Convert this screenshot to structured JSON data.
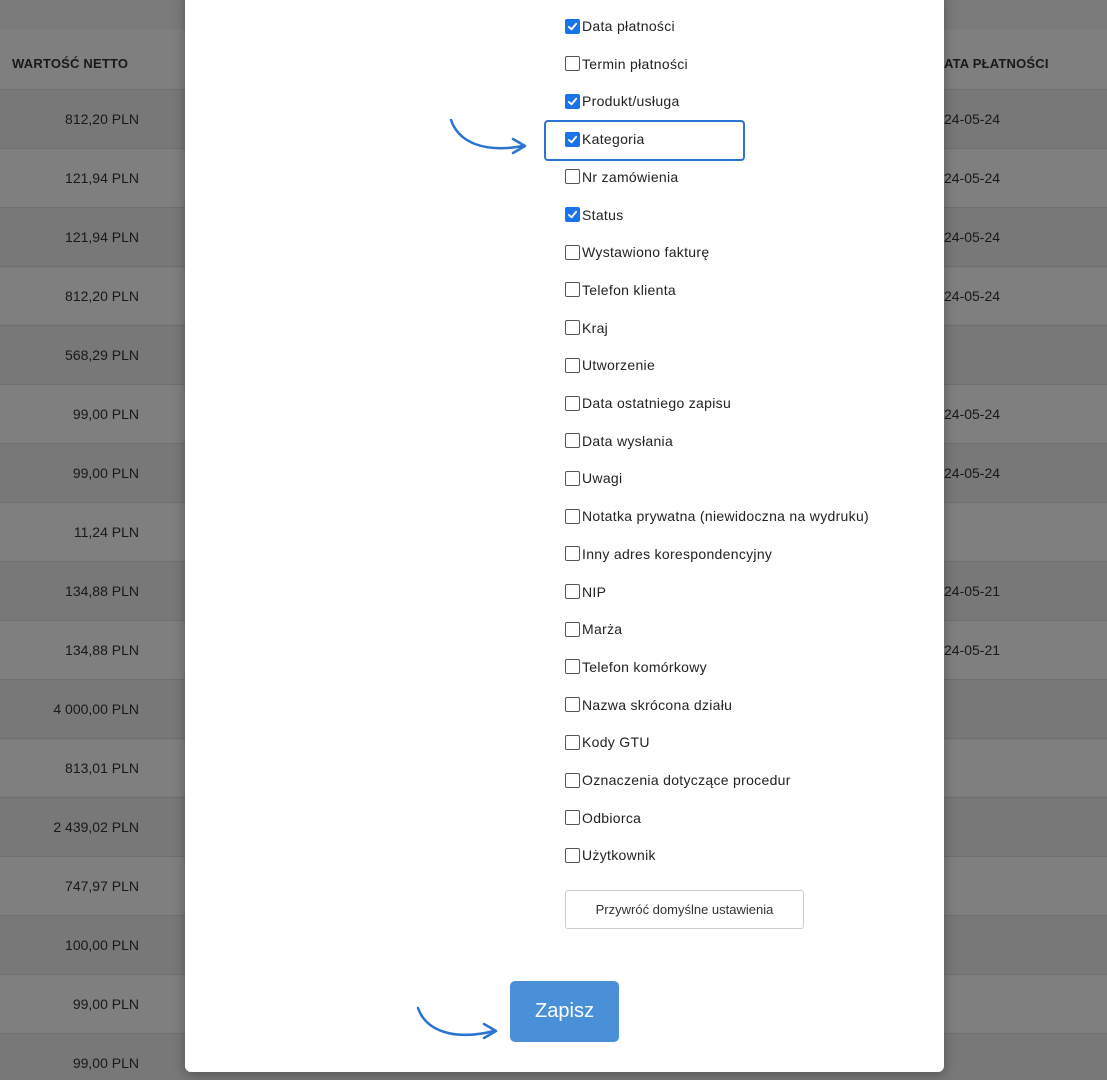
{
  "table": {
    "header_left": "WARTOŚĆ NETTO",
    "header_right": "ATA PŁATNOŚCI",
    "rows": [
      {
        "value": "812,20 PLN",
        "date": "24-05-24"
      },
      {
        "value": "121,94 PLN",
        "date": "24-05-24"
      },
      {
        "value": "121,94 PLN",
        "date": "24-05-24"
      },
      {
        "value": "812,20 PLN",
        "date": "24-05-24"
      },
      {
        "value": "568,29 PLN",
        "date": ""
      },
      {
        "value": "99,00 PLN",
        "date": "24-05-24"
      },
      {
        "value": "99,00 PLN",
        "date": "24-05-24"
      },
      {
        "value": "11,24 PLN",
        "date": ""
      },
      {
        "value": "134,88 PLN",
        "date": "24-05-21"
      },
      {
        "value": "134,88 PLN",
        "date": "24-05-21"
      },
      {
        "value": "4 000,00 PLN",
        "date": ""
      },
      {
        "value": "813,01 PLN",
        "date": ""
      },
      {
        "value": "2 439,02 PLN",
        "date": ""
      },
      {
        "value": "747,97 PLN",
        "date": ""
      },
      {
        "value": "100,00 PLN",
        "date": ""
      },
      {
        "value": "99,00 PLN",
        "date": ""
      },
      {
        "value": "99,00 PLN",
        "date": ""
      }
    ]
  },
  "modal": {
    "options": [
      {
        "label": "Data płatności",
        "checked": true
      },
      {
        "label": "Termin płatności",
        "checked": false
      },
      {
        "label": "Produkt/usługa",
        "checked": true
      },
      {
        "label": "Kategoria",
        "checked": true
      },
      {
        "label": "Nr zamówienia",
        "checked": false
      },
      {
        "label": "Status",
        "checked": true
      },
      {
        "label": "Wystawiono fakturę",
        "checked": false
      },
      {
        "label": "Telefon klienta",
        "checked": false
      },
      {
        "label": "Kraj",
        "checked": false
      },
      {
        "label": "Utworzenie",
        "checked": false
      },
      {
        "label": "Data ostatniego zapisu",
        "checked": false
      },
      {
        "label": "Data wysłania",
        "checked": false
      },
      {
        "label": "Uwagi",
        "checked": false
      },
      {
        "label": "Notatka prywatna (niewidoczna na wydruku)",
        "checked": false
      },
      {
        "label": "Inny adres korespondencyjny",
        "checked": false
      },
      {
        "label": "NIP",
        "checked": false
      },
      {
        "label": "Marża",
        "checked": false
      },
      {
        "label": "Telefon komórkowy",
        "checked": false
      },
      {
        "label": "Nazwa skrócona działu",
        "checked": false
      },
      {
        "label": "Kody GTU",
        "checked": false
      },
      {
        "label": "Oznaczenia dotyczące procedur",
        "checked": false
      },
      {
        "label": "Odbiorca",
        "checked": false
      },
      {
        "label": "Użytkownik",
        "checked": false
      }
    ],
    "reset_label": "Przywróć domyślne ustawienia",
    "save_label": "Zapisz"
  },
  "colors": {
    "accent": "#1a73e8",
    "save_button": "#4a90d9",
    "annotation": "#2b74d1"
  }
}
